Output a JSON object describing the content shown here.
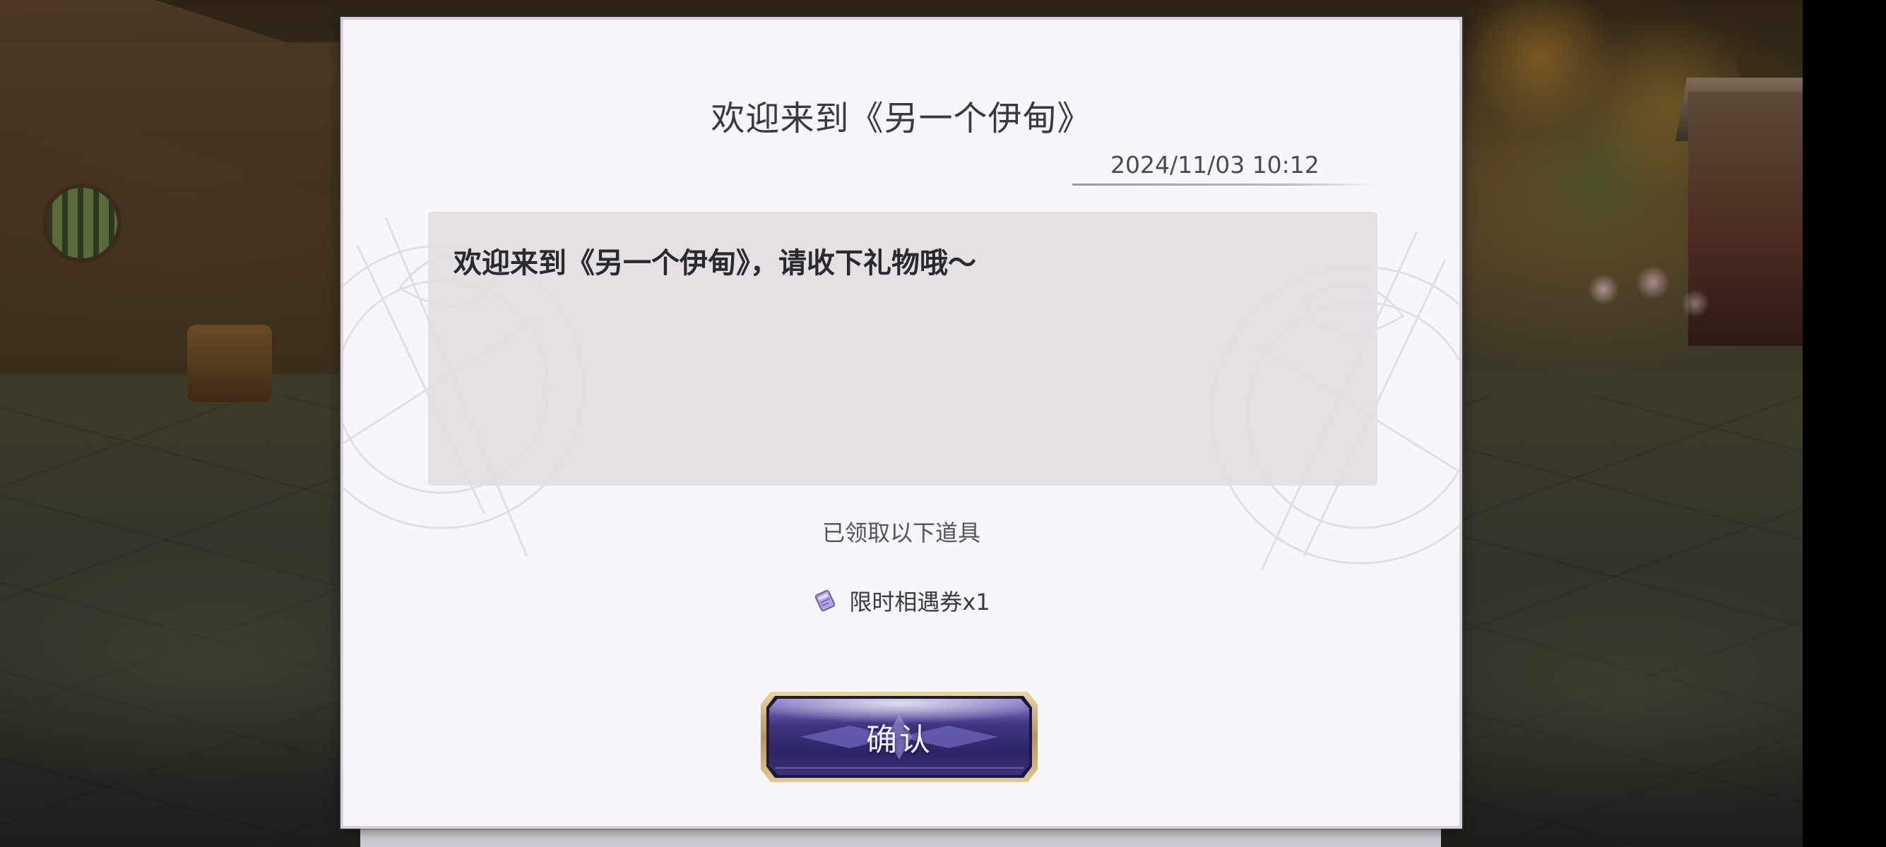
{
  "dialog": {
    "title": "欢迎来到《另一个伊甸》",
    "date": "2024/11/03 10:12",
    "message": "欢迎来到《另一个伊甸》，请收下礼物哦～",
    "received_label": "已领取以下道具",
    "items": [
      {
        "icon": "ticket-icon",
        "label": "限时相遇券x1"
      }
    ],
    "confirm_label": "确认"
  },
  "colors": {
    "panel_bg": "#f8f6fb",
    "message_bg": "#e2dde2",
    "button_purple": "#3b2f7a",
    "button_gold": "#c9a866",
    "ticket_purple": "#9b84d6"
  }
}
